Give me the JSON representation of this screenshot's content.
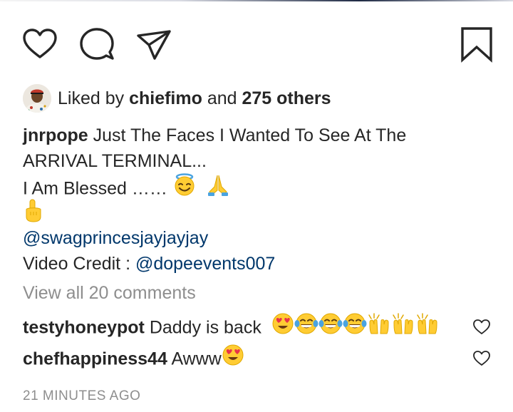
{
  "post_actions": {
    "like_icon": "heart-outline-icon",
    "comment_icon": "comment-bubble-icon",
    "share_icon": "paper-plane-icon",
    "save_icon": "bookmark-icon"
  },
  "likes": {
    "prefix": "Liked by",
    "user": "chiefimo",
    "connector": "and",
    "others": "275 others"
  },
  "caption": {
    "author": "jnrpope",
    "text_line1": "Just The Faces I Wanted To See At The",
    "text_line2": "ARRIVAL TERMINAL...",
    "text_line3": "I Am Blessed ……",
    "line3_emojis": [
      "smiling-face-with-halo-emoji",
      "folded-hands-emoji"
    ],
    "line4_emoji": "backhand-index-pointing-up-emoji",
    "mention": "@swagprincesjayjayjay",
    "credit_label": "Video Credit :",
    "credit_mention": "@dopeevents007"
  },
  "view_all_comments": "View all 20 comments",
  "comments": [
    {
      "user": "testyhoneypot",
      "text": "Daddy is back",
      "emojis": [
        "heart-eyes-emoji",
        "tears-of-joy-emoji",
        "tears-of-joy-emoji",
        "tears-of-joy-emoji",
        "raising-hands-emoji",
        "raising-hands-emoji",
        "raising-hands-emoji"
      ]
    },
    {
      "user": "chefhappiness44",
      "text": "Awww",
      "emojis": [
        "heart-eyes-emoji"
      ]
    }
  ],
  "timestamp": "21 MINUTES AGO",
  "colors": {
    "text": "#262626",
    "mention": "#00376b",
    "muted": "#8e8e8e",
    "emoji_yellow": "#ffcc33"
  }
}
